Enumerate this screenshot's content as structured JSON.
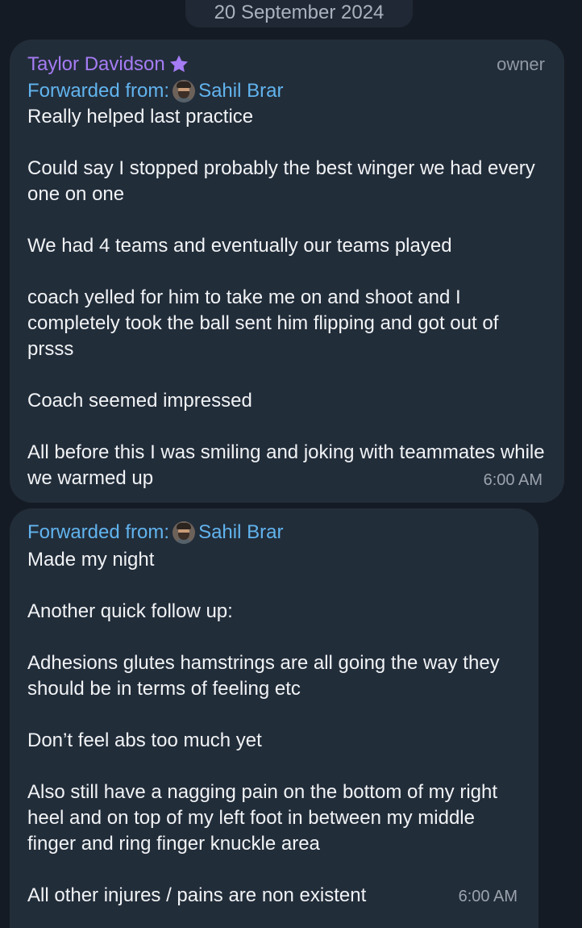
{
  "date_separator": "20 September 2024",
  "messages": [
    {
      "sender": "Taylor Davidson",
      "role": "owner",
      "forwarded_label": "Forwarded from:",
      "forwarded_from": "Sahil Brar",
      "text": "Really helped last practice\n\nCould say I stopped probably the best winger we had every one on one\n\nWe had 4 teams and eventually our teams played\n\ncoach yelled for him to take me on and shoot and I completely took the ball sent him flipping and got out of prsss\n\nCoach seemed impressed\n\nAll before this I was smiling and joking with teammates while we warmed up",
      "time": "6:00 AM"
    },
    {
      "forwarded_label": "Forwarded from:",
      "forwarded_from": "Sahil Brar",
      "text": "Made my night\n\nAnother quick follow up:\n\nAdhesions glutes hamstrings are all going the way they should be in terms of feeling etc\n\nDon’t feel abs too much yet\n\nAlso still have a nagging pain on the bottom of my right heel and on top of my left foot in between my middle finger and ring finger knuckle area\n\nAll other injures / pains are non existent",
      "time": "6:00 AM"
    }
  ],
  "colors": {
    "background": "#151b24",
    "bubble": "#222d3a",
    "sender_name": "#a57cf4",
    "forwarded": "#61b4ee",
    "text": "#f1f3f5",
    "meta": "#9aa3ad"
  },
  "icons": {
    "sender_badge": "star-icon",
    "forwarded_avatar": "avatar"
  }
}
